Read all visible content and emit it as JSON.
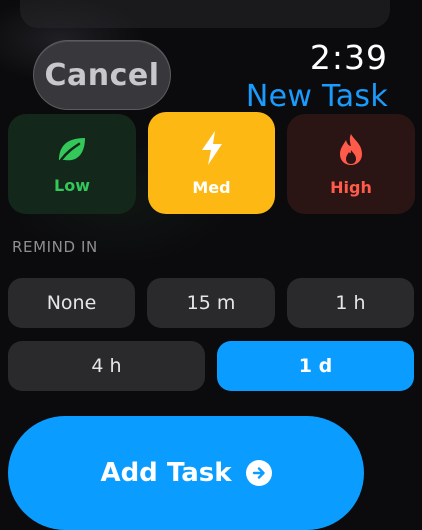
{
  "header": {
    "cancel_label": "Cancel",
    "time": "2:39",
    "title": "New Task"
  },
  "priority": {
    "selected": "Med",
    "options": [
      {
        "label": "Low",
        "icon": "leaf-icon",
        "color": "#34c759"
      },
      {
        "label": "Med",
        "icon": "bolt-icon",
        "color": "#fdb814"
      },
      {
        "label": "High",
        "icon": "flame-icon",
        "color": "#ff5a4a"
      }
    ]
  },
  "remind": {
    "section_label": "REMIND IN",
    "selected": "1 d",
    "options": [
      "None",
      "15 m",
      "1 h",
      "4 h",
      "1 d"
    ]
  },
  "actions": {
    "add_label": "Add Task",
    "add_icon": "arrow-right-circle-icon",
    "accent": "#0a9dff"
  }
}
